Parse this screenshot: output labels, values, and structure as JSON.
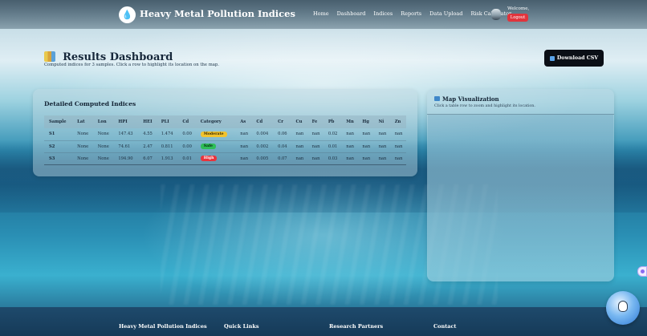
{
  "app": {
    "brand": "Heavy Metal Pollution Indices",
    "logo_icon": "water-drop-logo-icon"
  },
  "nav": {
    "items": [
      "Home",
      "Dashboard",
      "Indices",
      "Reports",
      "Data Upload",
      "Risk Calculator"
    ],
    "welcome": "Welcome,",
    "logout": "Logout"
  },
  "header": {
    "title": "Results Dashboard",
    "title_icon": "bar-chart-icon",
    "subtitle": "Computed indices for 3 samples. Click a row to highlight its location on the map.",
    "download_label": "Download CSV",
    "download_icon": "download-icon"
  },
  "results": {
    "title": "Detailed Computed Indices",
    "columns": [
      "Sample",
      "Lat",
      "Lon",
      "HPI",
      "HEI",
      "PLI",
      "Cd",
      "Category",
      "As",
      "Cd",
      "Cr",
      "Cu",
      "Fe",
      "Pb",
      "Mn",
      "Hg",
      "Ni",
      "Zn"
    ],
    "rows": [
      [
        "S1",
        "None",
        "None",
        "147.43",
        "4.55",
        "1.474",
        "0.00",
        "Moderate",
        "nan",
        "0.004",
        "0.06",
        "nan",
        "nan",
        "0.02",
        "nan",
        "nan",
        "nan",
        "nan"
      ],
      [
        "S2",
        "None",
        "None",
        "74.61",
        "2.47",
        "0.811",
        "0.00",
        "Safe",
        "nan",
        "0.002",
        "0.04",
        "nan",
        "nan",
        "0.01",
        "nan",
        "nan",
        "nan",
        "nan"
      ],
      [
        "S3",
        "None",
        "None",
        "194.90",
        "6.07",
        "1.913",
        "0.01",
        "High",
        "nan",
        "0.005",
        "0.07",
        "nan",
        "nan",
        "0.03",
        "nan",
        "nan",
        "nan",
        "nan"
      ]
    ],
    "category_colors": {
      "Moderate": "#f1c32e",
      "Safe": "#2ebe58",
      "High": "#e8343d"
    }
  },
  "map": {
    "title": "Map Visualization",
    "icon": "map-icon",
    "hint": "Click a table row to zoom and highlight its location."
  },
  "footer": {
    "columns": [
      "Heavy Metal Pollution Indices",
      "Quick Links",
      "Research Partners",
      "Contact"
    ]
  },
  "colors": {
    "accent": "#0b0f16",
    "logout": "#e0343c"
  }
}
